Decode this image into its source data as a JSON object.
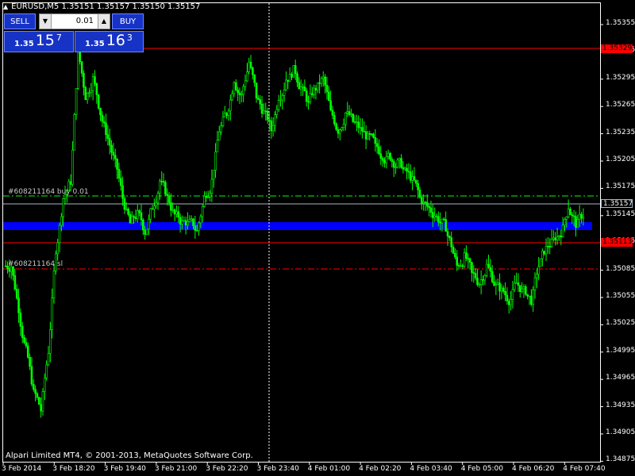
{
  "header": {
    "symbol_info": "EURUSD,M5  1.35151 1.35157 1.35150 1.35157"
  },
  "trade_panel": {
    "sell_label": "SELL",
    "buy_label": "BUY",
    "lot_value": "0.01",
    "sell_price": {
      "base": "1.35",
      "big": "15",
      "sup": "7"
    },
    "buy_price": {
      "base": "1.35",
      "big": "16",
      "sup": "3"
    }
  },
  "price_axis": {
    "ticks": [
      "1.35355",
      "1.35325",
      "1.35295",
      "1.35265",
      "1.35235",
      "1.35205",
      "1.35175",
      "1.35145",
      "1.35115",
      "1.35085",
      "1.35055",
      "1.35025",
      "1.34995",
      "1.34965",
      "1.34935",
      "1.34905",
      "1.34875"
    ],
    "current_price": "1.35157",
    "red_badge_top": "1.35329",
    "red_badge_bottom": "1.35113"
  },
  "time_axis": {
    "ticks": [
      "3 Feb 2014",
      "3 Feb 18:20",
      "3 Feb 19:40",
      "3 Feb 21:00",
      "3 Feb 22:20",
      "3 Feb 23:40",
      "4 Feb 01:00",
      "4 Feb 02:20",
      "4 Feb 03:40",
      "4 Feb 05:00",
      "4 Feb 06:20",
      "4 Feb 07:40"
    ]
  },
  "order_lines": {
    "buy_label": "#608211164 buy 0.01",
    "sl_label": "#608211164 sl"
  },
  "footer": {
    "copyright": "Alpari Limited MT4, © 2001-2013, MetaQuotes Software Corp."
  },
  "colors": {
    "background": "#000000",
    "candles": "#00ff00",
    "red_line": "#ff0000",
    "blue_band": "#0000ff",
    "panel_blue": "#1733c6"
  },
  "chart_data": {
    "type": "line",
    "symbol": "EURUSD",
    "timeframe": "M5",
    "ylim": [
      1.34875,
      1.35385
    ],
    "last_price": 1.35157,
    "series": [
      {
        "values": [
          1.351,
          1.3505,
          1.35,
          1.3495,
          1.3493,
          1.35,
          1.3512,
          1.3518,
          1.352,
          1.3535,
          1.353,
          1.3532,
          1.3528,
          1.3525,
          1.3522,
          1.3518,
          1.3515,
          1.3516,
          1.3514,
          1.3517,
          1.352,
          1.3518,
          1.3516,
          1.3515,
          1.3515,
          1.3514,
          1.3518,
          1.352,
          1.3526,
          1.3528,
          1.3532,
          1.353,
          1.3534,
          1.353,
          1.3528,
          1.3526,
          1.353,
          1.3532,
          1.3533,
          1.3531,
          1.3529,
          1.3531,
          1.3532,
          1.3528,
          1.3526,
          1.3528,
          1.3527,
          1.3526,
          1.3525,
          1.3524,
          1.3523,
          1.3523,
          1.3522,
          1.3521,
          1.352,
          1.3518,
          1.3517,
          1.3516,
          1.3515,
          1.3513,
          1.351,
          1.3511,
          1.3509,
          1.3508,
          1.351,
          1.3508,
          1.3507,
          1.3506,
          1.3508,
          1.3507,
          1.3506,
          1.351,
          1.3512,
          1.3513,
          1.3514,
          1.3517,
          1.3515,
          1.3516
        ]
      }
    ]
  }
}
